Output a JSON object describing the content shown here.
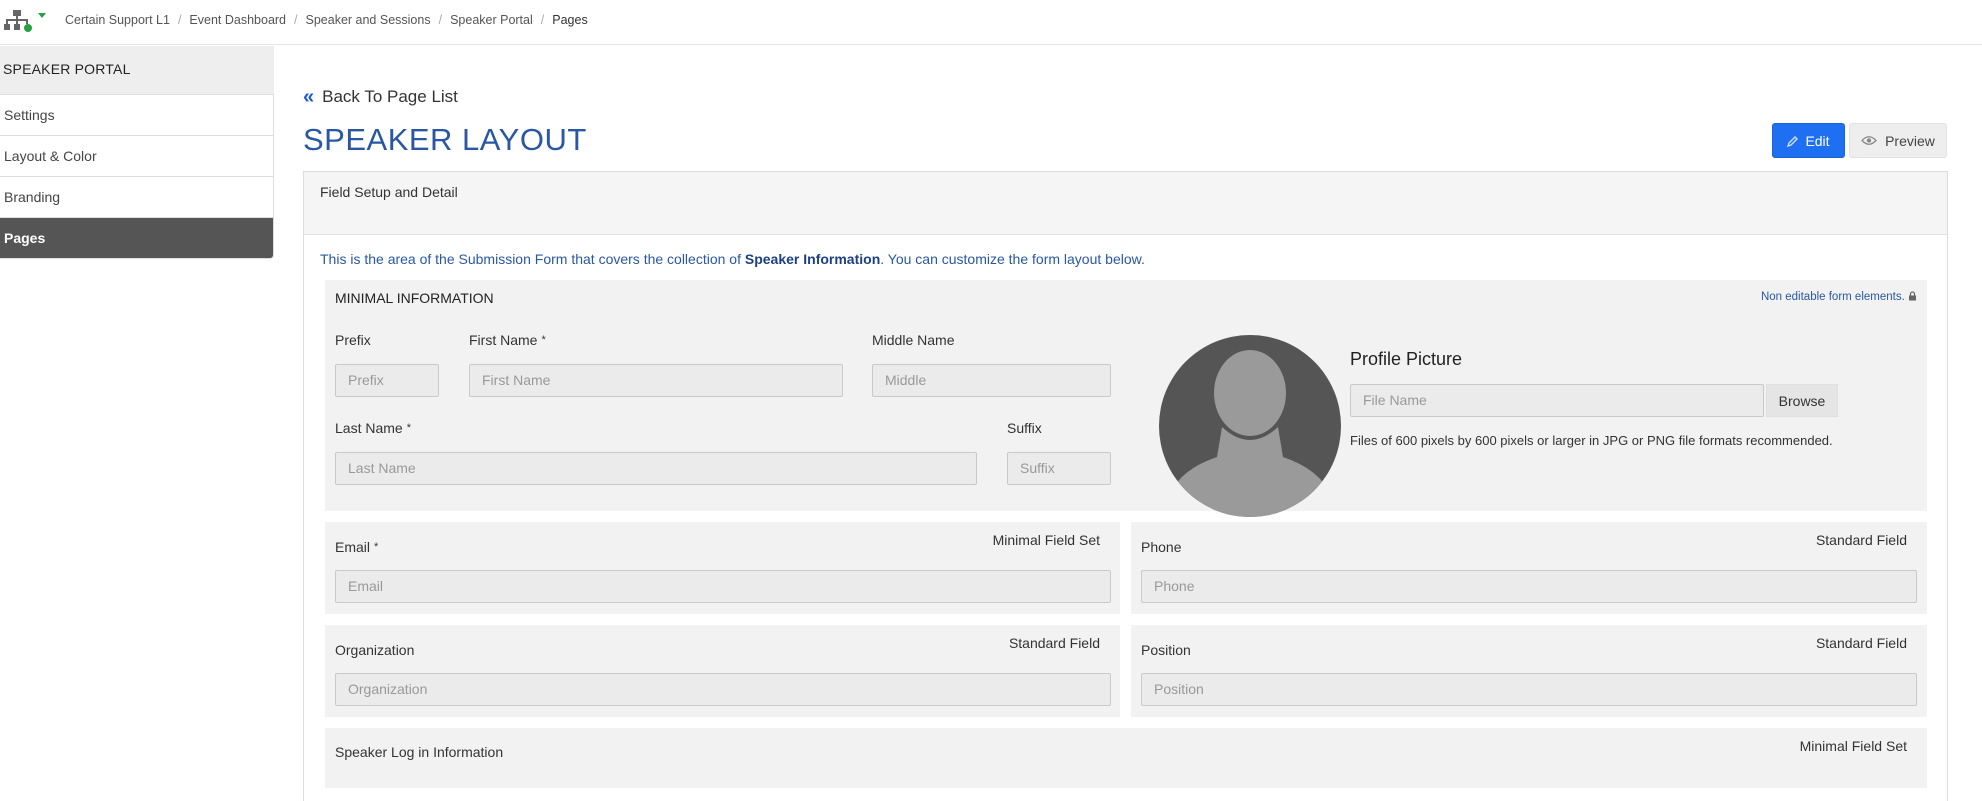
{
  "breadcrumb": [
    "Certain Support L1",
    "Event Dashboard",
    "Speaker and Sessions",
    "Speaker Portal",
    "Pages"
  ],
  "sidebar": {
    "header": "SPEAKER PORTAL",
    "items": [
      {
        "label": "Settings"
      },
      {
        "label": "Layout & Color"
      },
      {
        "label": "Branding"
      },
      {
        "label": "Pages",
        "active": true
      }
    ]
  },
  "main": {
    "back_label": "Back To Page List",
    "title": "SPEAKER LAYOUT",
    "edit_label": "Edit",
    "preview_label": "Preview",
    "panel_head": "Field Setup and Detail",
    "intro_pre": "This is the area of the Submission Form that covers the collection of ",
    "intro_bold": "Speaker Information",
    "intro_post": ". You can customize the form layout below."
  },
  "minimal": {
    "title": "MINIMAL INFORMATION",
    "non_editable": "Non editable form elements.",
    "prefix": {
      "label": "Prefix",
      "placeholder": "Prefix"
    },
    "first": {
      "label": "First Name",
      "placeholder": "First Name"
    },
    "middle": {
      "label": "Middle Name",
      "placeholder": "Middle"
    },
    "last": {
      "label": "Last Name",
      "placeholder": "Last Name"
    },
    "suffix": {
      "label": "Suffix",
      "placeholder": "Suffix"
    },
    "profile_title": "Profile Picture",
    "file_placeholder": "File Name",
    "browse": "Browse",
    "hint": "Files of 600 pixels by 600 pixels or larger in JPG or PNG file formats recommended.",
    "required_mark": "*"
  },
  "fields": {
    "email": {
      "label": "Email",
      "tag": "Minimal Field Set",
      "placeholder": "Email"
    },
    "phone": {
      "label": "Phone",
      "tag": "Standard Field",
      "placeholder": "Phone"
    },
    "organization": {
      "label": "Organization",
      "tag": "Standard Field",
      "placeholder": "Organization"
    },
    "position": {
      "label": "Position",
      "tag": "Standard Field",
      "placeholder": "Position"
    }
  },
  "login": {
    "title": "Speaker Log in Information",
    "tag": "Minimal Field Set"
  },
  "colors": {
    "accent": "#1f6ff2",
    "title": "#2957a4",
    "sidebar_active": "#555555"
  }
}
